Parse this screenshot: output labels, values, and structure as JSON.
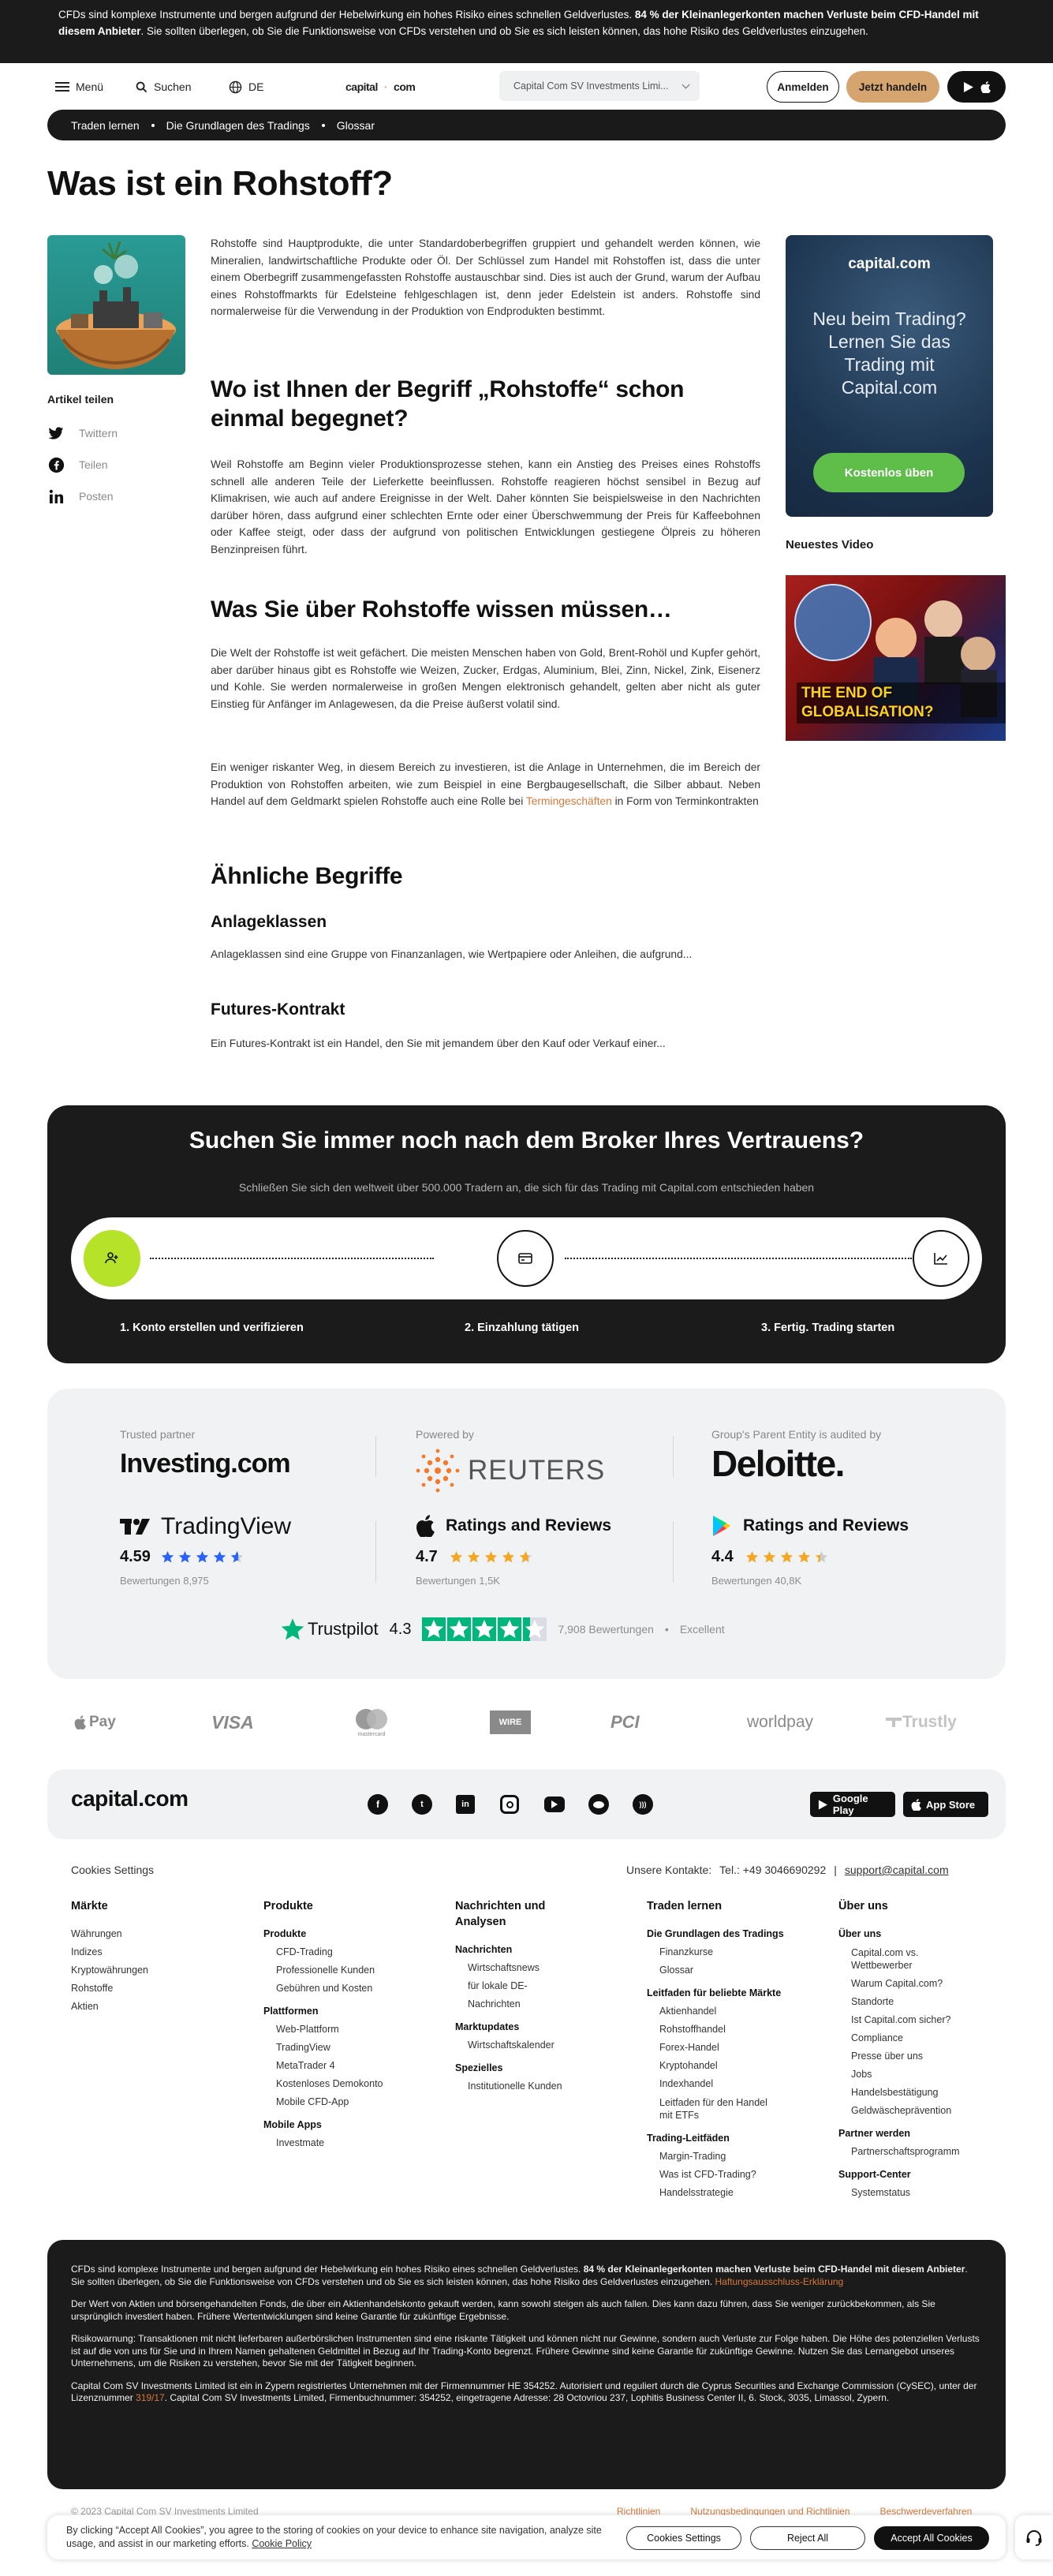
{
  "risk_banner": {
    "text_1": "CFDs sind komplexe Instrumente und bergen aufgrund der Hebelwirkung ein hohes Risiko eines schnellen Geldverlustes. ",
    "bold": "84 % der Kleinanleger­konten machen Verluste beim CFD-Handel mit diesem Anbieter",
    "text_2": ". Sie sollten überlegen, ob Sie die Funktionsweise von CFDs verstehen und ob Sie es sich leisten können, das hohe Risiko des Geldverlustes einzugehen."
  },
  "header": {
    "menu": "Menü",
    "search": "Suchen",
    "lang": "DE",
    "logo_a": "capital",
    "logo_b": "com",
    "entity": "Capital Com SV Investments Limi...",
    "login": "Anmelden",
    "trade": "Jetzt handeln"
  },
  "breadcrumb": [
    "Traden lernen",
    "Die Grundlagen des Tradings",
    "Glossar"
  ],
  "title": "Was ist ein Rohstoff?",
  "share": {
    "title": "Artikel teilen",
    "items": [
      "Twittern",
      "Teilen",
      "Posten"
    ]
  },
  "article": {
    "intro": "Rohstoffe sind Hauptprodukte, die unter Standardoberbegriffen gruppiert und gehandelt werden können, wie Mineralien, landwirtschaftliche Produkte oder Öl. Der Schlüssel zum Handel mit Rohstoffen ist, dass die unter einem Oberbegriff zusammengefassten Rohstoffe austauschbar sind. Dies ist auch der Grund, warum der Aufbau eines Rohstoffmarkts für Edelsteine fehlgeschlagen ist, denn jeder Edelstein ist anders. Rohstoffe sind normalerweise für die Verwendung in der Produktion von Endprodukten bestimmt.",
    "h2_1": "Wo ist Ihnen der Begriff „Rohstoffe“ schon einmal begegnet?",
    "p_1": "Weil Rohstoffe am Beginn vieler Produktionsprozesse stehen, kann ein Anstieg des Preises eines Rohstoffs schnell alle anderen Teile der Lieferkette beeinflussen. Rohstoffe reagieren höchst sensibel in Bezug auf Klimakrisen, wie auch auf andere Ereignisse in der Welt. Daher könnten Sie beispielsweise in den Nachrichten darüber hören, dass aufgrund einer schlechten Ernte oder einer Überschwemmung der Preis für Kaffeebohnen oder Kaffee steigt, oder dass der aufgrund von politischen Entwicklungen gestiegene Ölpreis zu höheren Benzinpreisen führt.",
    "h2_2": "Was Sie über Rohstoffe wissen müssen…",
    "p_2": "Die Welt der Rohstoffe ist weit gefächert. Die meisten Menschen haben von Gold, Brent-Rohöl und Kupfer gehört, aber darüber hinaus gibt es Rohstoffe wie Weizen, Zucker, Erdgas, Aluminium, Blei, Zinn, Nickel, Zink, Eisenerz und Kohle. Sie werden normalerweise in großen Mengen elektronisch gehandelt, gelten aber nicht als guter Einstieg für Anfänger im Anlagewesen, da die Preise äußerst volatil sind.",
    "p_3a": "Ein weniger riskanter Weg, in diesem Bereich zu investieren, ist die Anlage in Unternehmen, die im Bereich der Produktion von Rohstoffen arbeiten, wie zum Beispiel in eine Bergbaugesellschaft, die Silber abbaut. Neben Handel auf dem Geldmarkt spielen Rohstoffe auch eine Rolle bei ",
    "p_3_link": "Termingeschäften",
    "p_3b": " in Form von Terminkontrakten",
    "h2_3": "Ähnliche Begriffe",
    "term_1_title": "Anlageklassen",
    "term_1_text": "Anlageklassen sind eine Gruppe von Finanzanlagen, wie Wertpapiere oder Anleihen, die aufgrund...",
    "term_2_title": "Futures-Kontrakt",
    "term_2_text": "Ein Futures-Kontrakt ist ein Handel, den Sie mit jemandem über den Kauf oder Verkauf einer..."
  },
  "sidebar": {
    "logo": "capital.com",
    "text": "Neu beim Trading? Lernen Sie das Trading mit Capital.com",
    "button": "Kostenlos üben",
    "video_title": "Neuestes Video",
    "video_caption": "THE END OF GLOBALISATION?"
  },
  "broker": {
    "title": "Suchen Sie immer noch nach dem Broker Ihres Vertrauens?",
    "subtitle": "Schließen Sie sich den weltweit über 500.000 Tradern an, die sich für das Trading mit Capital.com entschieden haben",
    "steps": [
      "1. Konto erstellen und verifizieren",
      "2. Einzahlung tätigen",
      "3. Fertig. Trading starten"
    ]
  },
  "trust": {
    "partner_label": "Trusted partner",
    "partner_name": "Investing.com",
    "powered_label": "Powered by",
    "powered_name": "REUTERS",
    "audit_label": "Group's Parent Entity is audited by",
    "audit_name": "Deloitte.",
    "tradingview_name": "TradingView",
    "tradingview_rating": "4.59",
    "tradingview_count": "Bewertungen 8,975",
    "apple_name": "Ratings and Reviews",
    "apple_rating": "4.7",
    "apple_count": "Bewertungen 1,5K",
    "google_name": "Ratings and Reviews",
    "google_rating": "4.4",
    "google_count": "Bewertungen 40,8K",
    "trustpilot_name": "Trustpilot",
    "trustpilot_rating": "4.3",
    "trustpilot_count": "7,908 Bewertungen",
    "trustpilot_label": "Excellent",
    "ratings": {
      "tradingview": 4.59,
      "apple": 4.7,
      "google": 4.4,
      "trustpilot": 4.3
    }
  },
  "payments": [
    "Pay",
    "VISA",
    "mastercard",
    "WIRE",
    "PCI",
    "worldpay",
    "Trustly"
  ],
  "footer": {
    "logo": "capital.com",
    "socials": [
      "f",
      "t",
      "in",
      "ig",
      "yt",
      "rd",
      "rss"
    ],
    "google_play": "Google Play",
    "app_store": "App Store",
    "cookies": "Cookies Settings",
    "contact_label": "Unsere Kontakte:",
    "phone": "Tel.: +49 3046690292",
    "email": "support@capital.com",
    "col_maerkte": {
      "title": "Märkte",
      "items": [
        "Währungen",
        "Indizes",
        "Kryptowährungen",
        "Rohstoffe",
        "Aktien"
      ]
    },
    "col_produkte": {
      "title": "Produkte",
      "s1": "Produkte",
      "s1_items": [
        "CFD-Trading",
        "Professionelle Kunden",
        "Gebühren und Kosten"
      ],
      "s2": "Plattformen",
      "s2_items": [
        "Web-Plattform",
        "TradingView",
        "MetaTrader 4",
        "Kostenloses Demokonto",
        "Mobile CFD-App"
      ],
      "s3": "Mobile Apps",
      "s3_items": [
        "Investmate"
      ]
    },
    "col_news": {
      "title": "Nachrichten und Analysen",
      "s1": "Nachrichten",
      "s1_items": [
        "Wirtschaftsnews",
        "für lokale DE-Nachrichten"
      ],
      "s2": "Marktupdates",
      "s2_items": [
        "Wirtschaftskalender"
      ],
      "s3": "Spezielles",
      "s3_items": [
        "Institutionelle Kunden"
      ]
    },
    "col_learn": {
      "title": "Traden lernen",
      "s1": "Die Grundlagen des Tradings",
      "s1_items": [
        "Finanzkurse",
        "Glossar"
      ],
      "s2": "Leitfaden für beliebte Märkte",
      "s2_items": [
        "Aktienhandel",
        "Rohstoffhandel",
        "Forex-Handel",
        "Kryptohandel",
        "Indexhandel",
        "Leitfaden für den Handel mit ETFs"
      ],
      "s3": "Trading-Leitfäden",
      "s3_items": [
        "Margin-Trading",
        "Was ist CFD-Trading?",
        "Handelsstrategie"
      ]
    },
    "col_about": {
      "title": "Über uns",
      "s1": "Über uns",
      "s1_items": [
        "Capital.com vs. Wettbewerber",
        "Warum Capital.com?",
        "Standorte",
        "Ist Capital.com sicher?",
        "Compliance",
        "Presse über uns",
        "Jobs",
        "Handelsbestätigung",
        "Geldwäscheprävention"
      ],
      "s2": "Partner werden",
      "s2_items": [
        "Partnerschaftsprogramm"
      ],
      "s3": "Support-Center",
      "s3_items": [
        "Systemstatus"
      ]
    }
  },
  "disclaimer": {
    "p1a": "CFDs sind komplexe Instrumente und bergen aufgrund der Hebelwirkung ein hohes Risiko eines schnellen Geldverlustes. ",
    "p1b": "84 % der Kleinanlegerkonten machen Verluste beim CFD-Handel mit diesem Anbieter",
    "p1c": ". Sie sollten überlegen, ob Sie die Funktionsweise von CFDs verstehen und ob Sie es sich leisten können, das hohe Risiko des Geldverlustes einzugehen. ",
    "p1_link": "Haftungsausschluss-Erklärung",
    "p2": "Der Wert von Aktien und börsengehandelten Fonds, die über ein Aktienhandelskonto gekauft werden, kann sowohl steigen als auch fallen. Dies kann dazu führen, dass Sie weniger zurückbekommen, als Sie ursprünglich investiert haben. Frühere Wertentwicklungen sind keine Garantie für zukünftige Ergebnisse.",
    "p3": "Risikowarnung: Transaktionen mit nicht lieferbaren außerbörslichen Instrumenten sind eine riskante Tätigkeit und können nicht nur Gewinne, sondern auch Verluste zur Folge haben. Die Höhe des potenziellen Verlusts ist auf die von uns für Sie und in Ihrem Namen gehaltenen Geldmittel in Bezug auf Ihr Trading-Konto begrenzt. Frühere Gewinne sind keine Garantie für zukünftige Gewinne. Nutzen Sie das Lernangebot unseres Unternehmens, um die Risiken zu verstehen, bevor Sie mit der Tätigkeit beginnen.",
    "p4a": "Capital Com SV Investments Limited ist ein in Zypern registriertes Unternehmen mit der Firmennummer HE 354252. Autorisiert und reguliert durch die Cyprus Securities and Exchange Commission (CySEC), unter der Lizenznummer ",
    "p4_link": "319/17",
    "p4b": ". Capital Com SV Investments Limited, Firmenbuchnummer: 354252, eingetragene Adresse: 28 Octovriou 237, Lophitis Business Center II, 6. Stock, 3035, Limassol, Zypern."
  },
  "bottom": {
    "copyright": "© 2023 Capital Com SV Investments Limited",
    "links": [
      "Richtlinien",
      "Nutzungsbedingungen und Richtlinien",
      "Beschwerdeverfahren"
    ]
  },
  "cookie": {
    "text_a": "By clicking “Accept All Cookies”, you agree to the storing of cookies on your device to enhance site navigation, analyze site usage, and assist in our marketing efforts. ",
    "link": "Cookie Policy",
    "settings": "Cookies Settings",
    "reject": "Reject All",
    "accept": "Accept All Cookies"
  },
  "colors": {
    "accent": "#d6a46e",
    "green": "#5fbd4a",
    "dark": "#1b1b1b",
    "link": "#d9783a"
  }
}
